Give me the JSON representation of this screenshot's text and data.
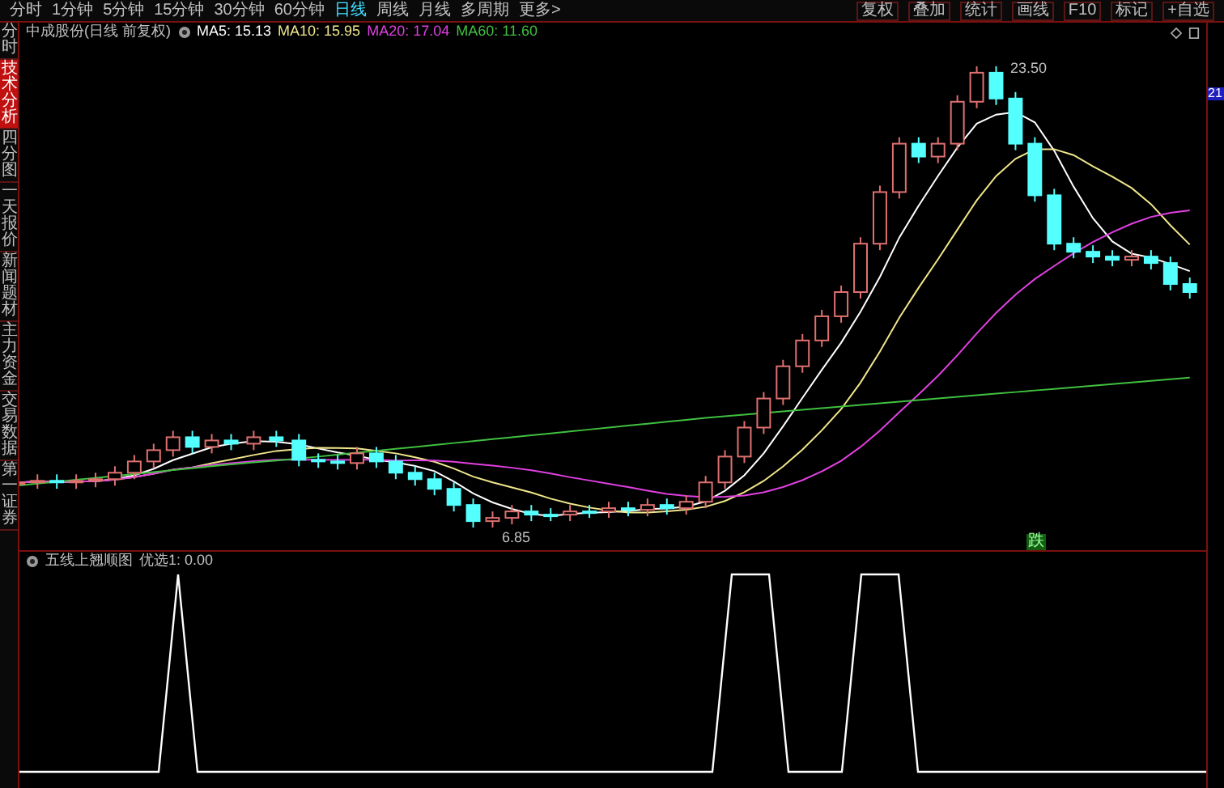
{
  "toolbar": {
    "periods": [
      {
        "label": "分时",
        "selected": false
      },
      {
        "label": "1分钟",
        "selected": false
      },
      {
        "label": "5分钟",
        "selected": false
      },
      {
        "label": "15分钟",
        "selected": false
      },
      {
        "label": "30分钟",
        "selected": false
      },
      {
        "label": "60分钟",
        "selected": false
      },
      {
        "label": "日线",
        "selected": true
      },
      {
        "label": "周线",
        "selected": false
      },
      {
        "label": "月线",
        "selected": false
      },
      {
        "label": "多周期",
        "selected": false
      },
      {
        "label": "更多>",
        "selected": false
      }
    ],
    "actions": [
      "复权",
      "叠加",
      "统计",
      "画线",
      "F10",
      "标记",
      "+自选"
    ]
  },
  "side_tabs": [
    {
      "label": "分时",
      "selected": false
    },
    {
      "label": "技术分析",
      "selected": true
    },
    {
      "label": "四分图",
      "selected": false
    },
    {
      "label": "一天报价",
      "selected": false
    },
    {
      "label": "新闻题材",
      "selected": false
    },
    {
      "label": "主力资金",
      "selected": false
    },
    {
      "label": "交易数据",
      "selected": false
    },
    {
      "label": "第一证券",
      "selected": false
    }
  ],
  "chart": {
    "title": "中成股份(日线 前复权)",
    "ma": [
      {
        "label": "MA5: 15.13",
        "color": "#ffffff"
      },
      {
        "label": "MA10: 15.95",
        "color": "#f0e68c"
      },
      {
        "label": "MA20: 17.04",
        "color": "#e040e0"
      },
      {
        "label": "MA60: 11.60",
        "color": "#40c040"
      }
    ],
    "high_label": "23.50",
    "low_label": "6.85",
    "price_tag": "21",
    "signal": "跌"
  },
  "indicator": {
    "title": "五线上翘顺图",
    "value": "优选1: 0.00"
  }
}
